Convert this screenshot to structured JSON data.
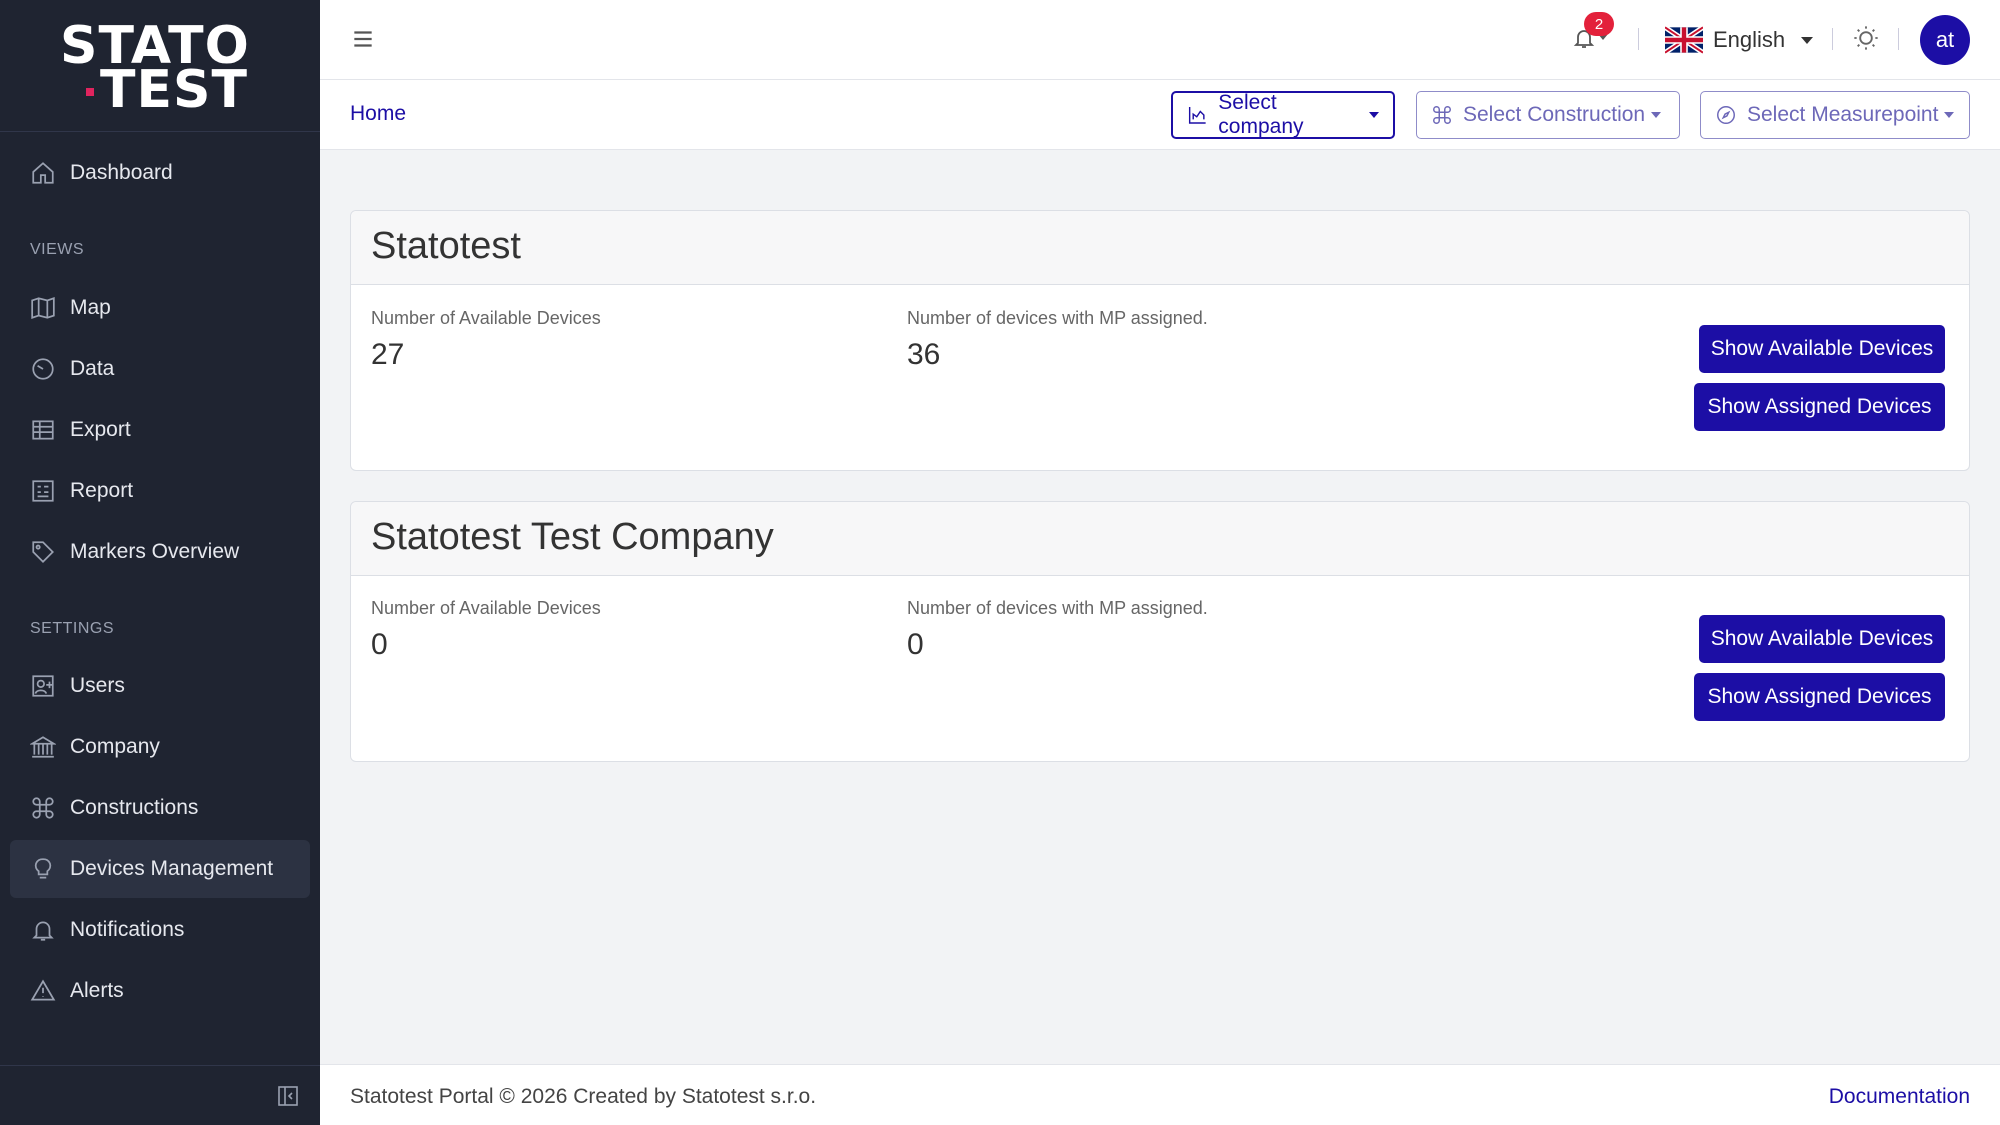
{
  "brand": {
    "line1": "STATO",
    "line2": "TEST"
  },
  "sidebar": {
    "dashboard": "Dashboard",
    "views_label": "VIEWS",
    "views": [
      "Map",
      "Data",
      "Export",
      "Report",
      "Markers Overview"
    ],
    "settings_label": "SETTINGS",
    "settings": [
      "Users",
      "Company",
      "Constructions",
      "Devices Management",
      "Notifications",
      "Alerts"
    ],
    "active_item": "Devices Management"
  },
  "header": {
    "notifications_count": "2",
    "language": "English",
    "avatar_initials": "at"
  },
  "breadcrumb": "Home",
  "selectors": {
    "company": "Select company",
    "construction": "Select Construction",
    "measurepoint": "Select Measurepoint"
  },
  "companies": [
    {
      "name": "Statotest",
      "available_label": "Number of Available Devices",
      "available_value": "27",
      "assigned_label": "Number of devices with MP assigned.",
      "assigned_value": "36",
      "show_available": "Show Available Devices",
      "show_assigned": "Show Assigned Devices"
    },
    {
      "name": "Statotest Test Company",
      "available_label": "Number of Available Devices",
      "available_value": "0",
      "assigned_label": "Number of devices with MP assigned.",
      "assigned_value": "0",
      "show_available": "Show Available Devices",
      "show_assigned": "Show Assigned Devices"
    }
  ],
  "footer": {
    "text": "Statotest Portal © 2026 Created by Statotest s.r.o.",
    "link": "Documentation"
  },
  "colors": {
    "primary": "#1c0ea5",
    "sidebar_bg": "#1f2431",
    "badge": "#e3213b"
  }
}
